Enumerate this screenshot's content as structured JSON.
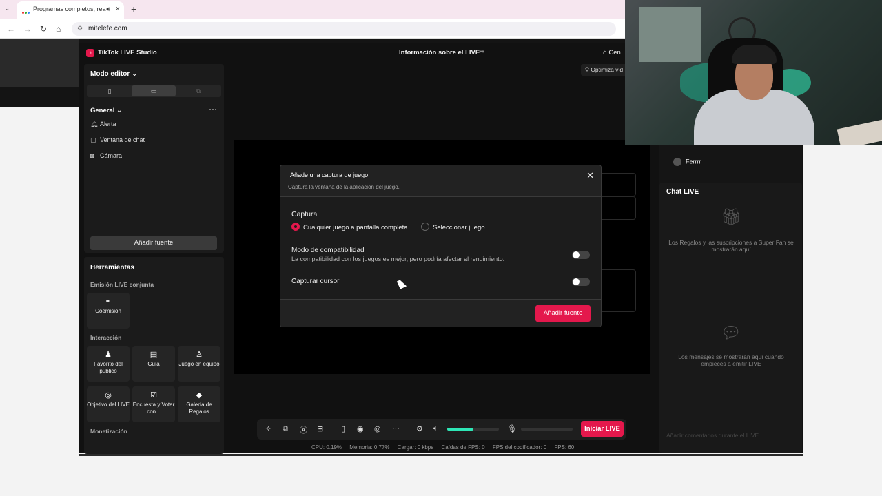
{
  "browser": {
    "tab_title": "Programas completos, rea",
    "url": "mitelefe.com",
    "new_tab": "+"
  },
  "studio": {
    "app_title": "TikTok LIVE Studio",
    "center_title": "Información sobre el LIVE",
    "right_label": "Cen",
    "optimize_label": "Optimiza vid",
    "mode_editor": "Modo editor",
    "general": "General",
    "sources": [
      {
        "icon": "bell-icon",
        "label": "Alerta"
      },
      {
        "icon": "chat-window-icon",
        "label": "Ventana de chat"
      },
      {
        "icon": "camera-icon",
        "label": "Cámara"
      }
    ],
    "add_source": "Añadir fuente",
    "tools": {
      "title": "Herramientas",
      "section_joint": "Emisión LIVE conjunta",
      "coemision": "Coemisión",
      "section_interaction": "Interacción",
      "interaction_items": [
        {
          "icon": "audience-icon",
          "label": "Favorito del público"
        },
        {
          "icon": "guide-icon",
          "label": "Guía"
        },
        {
          "icon": "team-game-icon",
          "label": "Juego en equipo"
        },
        {
          "icon": "target-icon",
          "label": "Objetivo del LIVE"
        },
        {
          "icon": "poll-icon",
          "label": "Encuesta y Votar con..."
        },
        {
          "icon": "gift-gallery-icon",
          "label": "Galería de Regalos"
        }
      ],
      "section_monetization": "Monetización"
    },
    "viewer_name": "Ferrrr",
    "chat": {
      "title": "Chat LIVE",
      "gifts_msg": "Los Regalos y las suscripciones a Super Fan se mostrarán aquí",
      "messages_msg": "Los mensajes se mostrarán aquí cuando empieces a emitir LIVE",
      "input_placeholder": "Añadir comentarios durante el LIVE"
    },
    "go_live": "Iniciar LIVE",
    "stats": {
      "cpu": "CPU:  0.19%",
      "memory": "Memoria:  0.77%",
      "load": "Cargar:  0 kbps",
      "fps_drops": "Caídas de FPS:  0",
      "encoder_fps": "FPS del codificador:  0",
      "fps": "FPS:  60"
    },
    "volume_level": 0.5
  },
  "modal": {
    "title": "Añade una captura de juego",
    "subtitle": "Captura la ventana de la aplicación del juego.",
    "capture_label": "Captura",
    "option_fullscreen": "Cualquier juego a pantalla completa",
    "option_select": "Seleccionar juego",
    "compat_title": "Modo de compatibilidad",
    "compat_desc": "La compatibilidad con los juegos es mejor, pero podría afectar al rendimiento.",
    "cursor_title": "Capturar cursor",
    "add_button": "Añadir fuente"
  },
  "colors": {
    "accent": "#e4184c",
    "volume": "#2ee6b6"
  }
}
